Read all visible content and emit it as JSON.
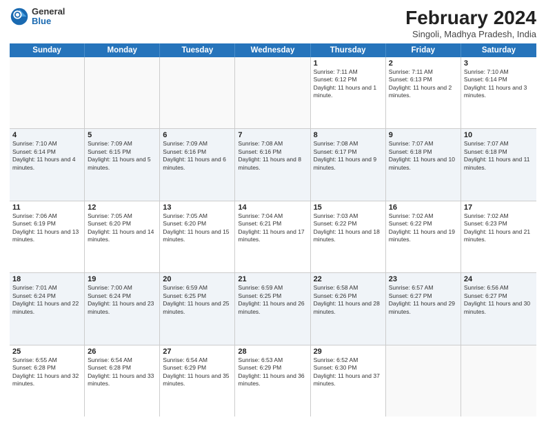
{
  "header": {
    "logo": {
      "general": "General",
      "blue": "Blue"
    },
    "month_year": "February 2024",
    "location": "Singoli, Madhya Pradesh, India"
  },
  "days_of_week": [
    "Sunday",
    "Monday",
    "Tuesday",
    "Wednesday",
    "Thursday",
    "Friday",
    "Saturday"
  ],
  "weeks": [
    [
      {
        "day": "",
        "info": ""
      },
      {
        "day": "",
        "info": ""
      },
      {
        "day": "",
        "info": ""
      },
      {
        "day": "",
        "info": ""
      },
      {
        "day": "1",
        "info": "Sunrise: 7:11 AM\nSunset: 6:12 PM\nDaylight: 11 hours and 1 minute."
      },
      {
        "day": "2",
        "info": "Sunrise: 7:11 AM\nSunset: 6:13 PM\nDaylight: 11 hours and 2 minutes."
      },
      {
        "day": "3",
        "info": "Sunrise: 7:10 AM\nSunset: 6:14 PM\nDaylight: 11 hours and 3 minutes."
      }
    ],
    [
      {
        "day": "4",
        "info": "Sunrise: 7:10 AM\nSunset: 6:14 PM\nDaylight: 11 hours and 4 minutes."
      },
      {
        "day": "5",
        "info": "Sunrise: 7:09 AM\nSunset: 6:15 PM\nDaylight: 11 hours and 5 minutes."
      },
      {
        "day": "6",
        "info": "Sunrise: 7:09 AM\nSunset: 6:16 PM\nDaylight: 11 hours and 6 minutes."
      },
      {
        "day": "7",
        "info": "Sunrise: 7:08 AM\nSunset: 6:16 PM\nDaylight: 11 hours and 8 minutes."
      },
      {
        "day": "8",
        "info": "Sunrise: 7:08 AM\nSunset: 6:17 PM\nDaylight: 11 hours and 9 minutes."
      },
      {
        "day": "9",
        "info": "Sunrise: 7:07 AM\nSunset: 6:18 PM\nDaylight: 11 hours and 10 minutes."
      },
      {
        "day": "10",
        "info": "Sunrise: 7:07 AM\nSunset: 6:18 PM\nDaylight: 11 hours and 11 minutes."
      }
    ],
    [
      {
        "day": "11",
        "info": "Sunrise: 7:06 AM\nSunset: 6:19 PM\nDaylight: 11 hours and 13 minutes."
      },
      {
        "day": "12",
        "info": "Sunrise: 7:05 AM\nSunset: 6:20 PM\nDaylight: 11 hours and 14 minutes."
      },
      {
        "day": "13",
        "info": "Sunrise: 7:05 AM\nSunset: 6:20 PM\nDaylight: 11 hours and 15 minutes."
      },
      {
        "day": "14",
        "info": "Sunrise: 7:04 AM\nSunset: 6:21 PM\nDaylight: 11 hours and 17 minutes."
      },
      {
        "day": "15",
        "info": "Sunrise: 7:03 AM\nSunset: 6:22 PM\nDaylight: 11 hours and 18 minutes."
      },
      {
        "day": "16",
        "info": "Sunrise: 7:02 AM\nSunset: 6:22 PM\nDaylight: 11 hours and 19 minutes."
      },
      {
        "day": "17",
        "info": "Sunrise: 7:02 AM\nSunset: 6:23 PM\nDaylight: 11 hours and 21 minutes."
      }
    ],
    [
      {
        "day": "18",
        "info": "Sunrise: 7:01 AM\nSunset: 6:24 PM\nDaylight: 11 hours and 22 minutes."
      },
      {
        "day": "19",
        "info": "Sunrise: 7:00 AM\nSunset: 6:24 PM\nDaylight: 11 hours and 23 minutes."
      },
      {
        "day": "20",
        "info": "Sunrise: 6:59 AM\nSunset: 6:25 PM\nDaylight: 11 hours and 25 minutes."
      },
      {
        "day": "21",
        "info": "Sunrise: 6:59 AM\nSunset: 6:25 PM\nDaylight: 11 hours and 26 minutes."
      },
      {
        "day": "22",
        "info": "Sunrise: 6:58 AM\nSunset: 6:26 PM\nDaylight: 11 hours and 28 minutes."
      },
      {
        "day": "23",
        "info": "Sunrise: 6:57 AM\nSunset: 6:27 PM\nDaylight: 11 hours and 29 minutes."
      },
      {
        "day": "24",
        "info": "Sunrise: 6:56 AM\nSunset: 6:27 PM\nDaylight: 11 hours and 30 minutes."
      }
    ],
    [
      {
        "day": "25",
        "info": "Sunrise: 6:55 AM\nSunset: 6:28 PM\nDaylight: 11 hours and 32 minutes."
      },
      {
        "day": "26",
        "info": "Sunrise: 6:54 AM\nSunset: 6:28 PM\nDaylight: 11 hours and 33 minutes."
      },
      {
        "day": "27",
        "info": "Sunrise: 6:54 AM\nSunset: 6:29 PM\nDaylight: 11 hours and 35 minutes."
      },
      {
        "day": "28",
        "info": "Sunrise: 6:53 AM\nSunset: 6:29 PM\nDaylight: 11 hours and 36 minutes."
      },
      {
        "day": "29",
        "info": "Sunrise: 6:52 AM\nSunset: 6:30 PM\nDaylight: 11 hours and 37 minutes."
      },
      {
        "day": "",
        "info": ""
      },
      {
        "day": "",
        "info": ""
      }
    ]
  ]
}
